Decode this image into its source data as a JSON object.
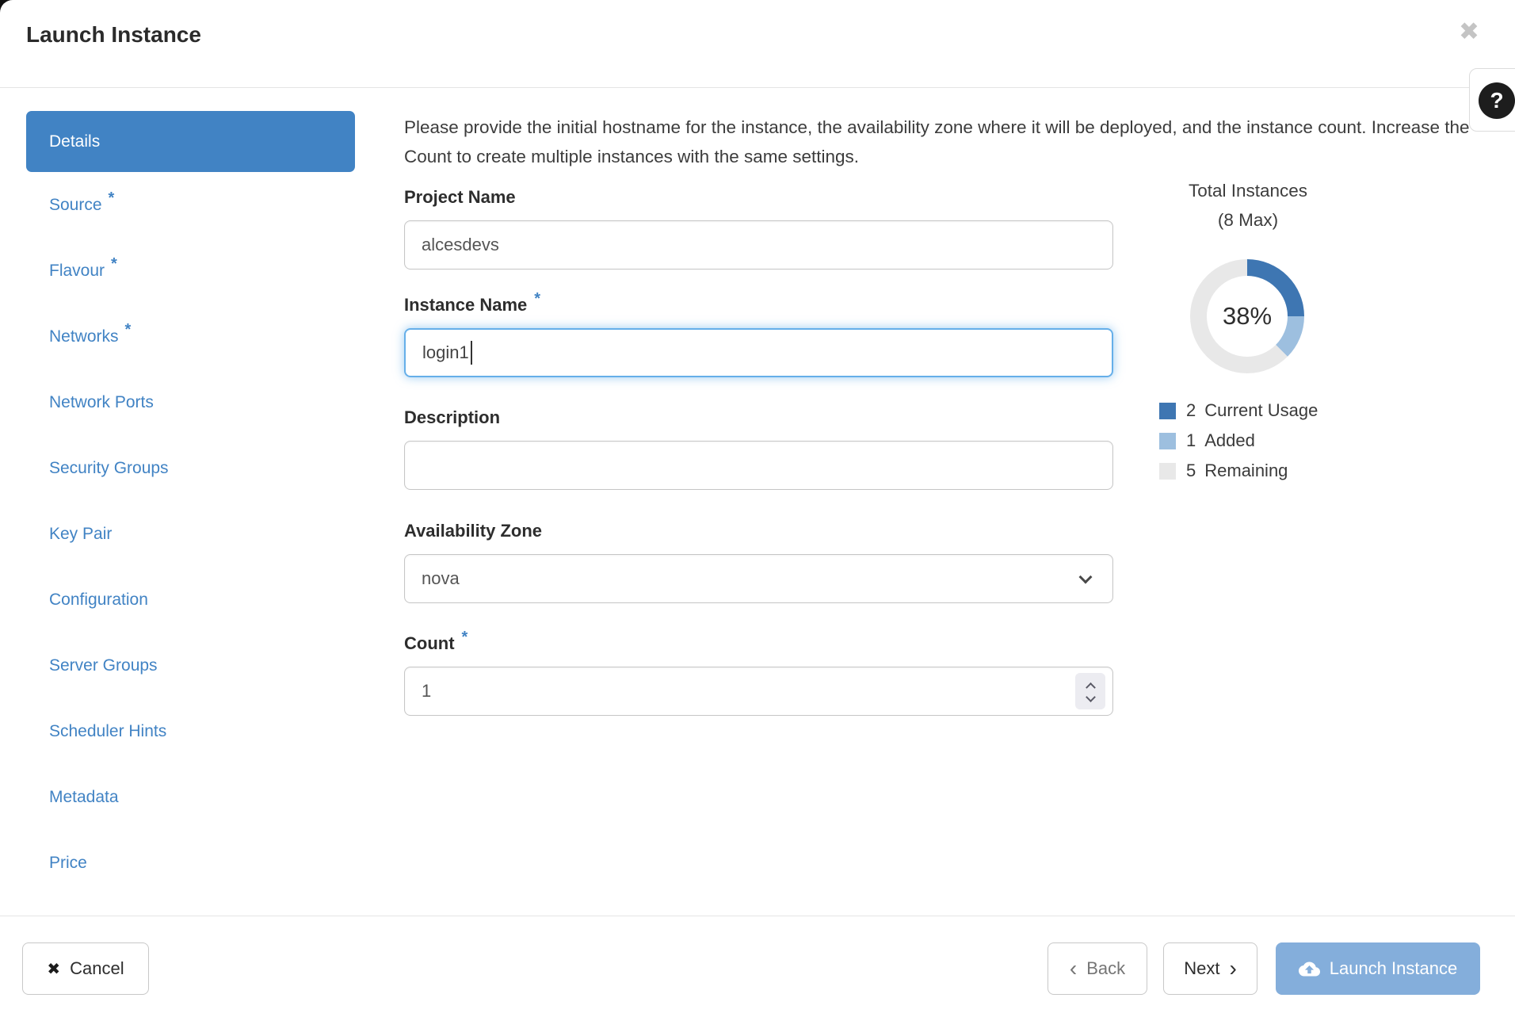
{
  "window": {
    "title": "Launch Instance",
    "close_icon": "✖"
  },
  "help": {
    "label": "?"
  },
  "sidebar": {
    "items": [
      {
        "label": "Details",
        "star": ""
      },
      {
        "label": "Source",
        "star": "*"
      },
      {
        "label": "Flavour",
        "star": "*"
      },
      {
        "label": "Networks",
        "star": "*"
      },
      {
        "label": "Network Ports",
        "star": ""
      },
      {
        "label": "Security Groups",
        "star": ""
      },
      {
        "label": "Key Pair",
        "star": ""
      },
      {
        "label": "Configuration",
        "star": ""
      },
      {
        "label": "Server Groups",
        "star": ""
      },
      {
        "label": "Scheduler Hints",
        "star": ""
      },
      {
        "label": "Metadata",
        "star": ""
      },
      {
        "label": "Price",
        "star": ""
      }
    ]
  },
  "main": {
    "intro": "Please provide the initial hostname for the instance, the availability zone where it will be deployed, and the instance count. Increase the Count to create multiple instances with the same settings.",
    "fields": {
      "project_name": {
        "label": "Project Name",
        "star": "",
        "value": "alcesdevs"
      },
      "instance_name": {
        "label": "Instance Name",
        "star": "*",
        "value": "login1"
      },
      "description": {
        "label": "Description",
        "star": "",
        "value": ""
      },
      "availability_zone": {
        "label": "Availability Zone",
        "star": "",
        "value": "nova"
      },
      "count": {
        "label": "Count",
        "star": "*",
        "value": "1"
      }
    }
  },
  "quota": {
    "title": "Total Instances",
    "subtitle": "(8 Max)",
    "percent": "38%",
    "max": 8,
    "segments": [
      {
        "value": 2,
        "label": "Current Usage",
        "color": "#3e76b2",
        "deg": 90
      },
      {
        "value": 1,
        "label": "Added",
        "color": "#9dbfdf",
        "deg": 45
      },
      {
        "value": 5,
        "label": "Remaining",
        "color": "#e8e8e8",
        "deg": 225
      }
    ]
  },
  "footer": {
    "cancel": "Cancel",
    "cancel_icon": "✖",
    "back": "Back",
    "back_chevron": "‹",
    "next": "Next",
    "next_chevron": "›",
    "launch": "Launch Instance"
  },
  "colors": {
    "accent": "#4183c4",
    "focus_glow": "#66afe9",
    "launch_button": "#84aedb"
  }
}
